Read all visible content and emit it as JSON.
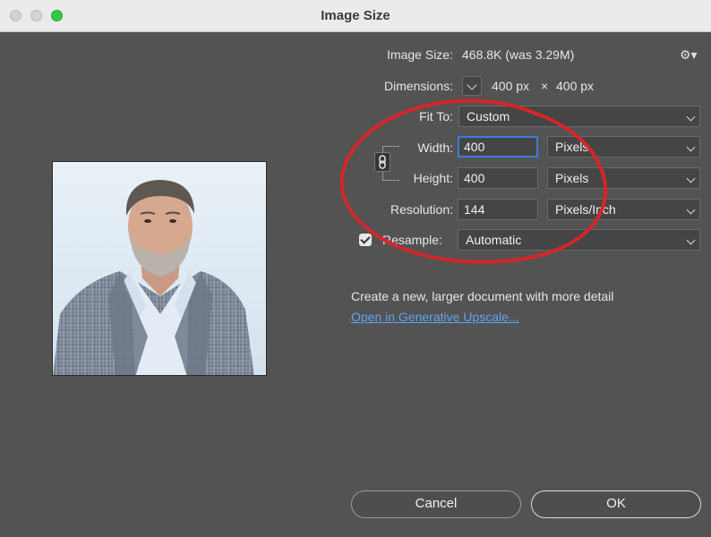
{
  "window": {
    "title": "Image Size"
  },
  "image_size": {
    "label": "Image Size:",
    "value": "468.8K (was 3.29M)"
  },
  "dimensions": {
    "label": "Dimensions:",
    "width": "400 px",
    "times": "×",
    "height": "400 px"
  },
  "fit_to": {
    "label": "Fit To:",
    "value": "Custom"
  },
  "width": {
    "label": "Width:",
    "value": "400",
    "unit": "Pixels"
  },
  "height": {
    "label": "Height:",
    "value": "400",
    "unit": "Pixels"
  },
  "resolution": {
    "label": "Resolution:",
    "value": "144",
    "unit": "Pixels/Inch"
  },
  "resample": {
    "label": "Resample:",
    "checked": true,
    "value": "Automatic"
  },
  "upscale": {
    "description": "Create a new, larger document with more detail",
    "link": "Open in Generative Upscale..."
  },
  "buttons": {
    "cancel": "Cancel",
    "ok": "OK"
  },
  "icons": {
    "settings": "gear-icon",
    "constrain": "link-icon"
  },
  "colors": {
    "focus_border": "#3d7cd6",
    "link": "#5fa3f2",
    "annotation": "#d4262a"
  }
}
